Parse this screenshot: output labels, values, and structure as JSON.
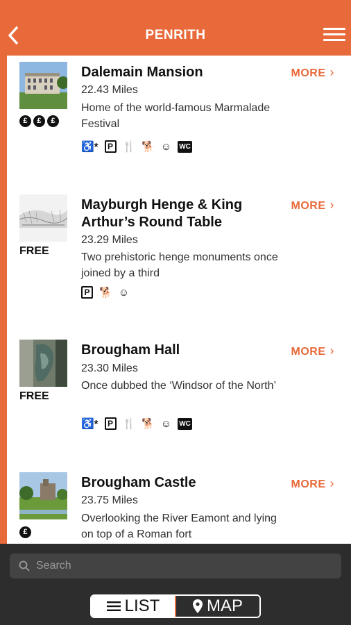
{
  "header": {
    "title": "PENRITH"
  },
  "items": [
    {
      "name": "Dalemain Mansion",
      "distance": "22.43 Miles",
      "description": "Home of the world-famous Marmalade Festival",
      "more": "MORE",
      "price_coins": 3,
      "price_text": ""
    },
    {
      "name": "Mayburgh Henge & King Arthur’s Round Table",
      "distance": "23.29 Miles",
      "description": "Two prehistoric henge monuments once joined by a third",
      "more": "MORE",
      "price_coins": 0,
      "price_text": "FREE"
    },
    {
      "name": "Brougham Hall",
      "distance": "23.30 Miles",
      "description": "Once dubbed the ‘Windsor of the North’",
      "more": "MORE",
      "price_coins": 0,
      "price_text": "FREE"
    },
    {
      "name": "Brougham Castle",
      "distance": "23.75 Miles",
      "description": "Overlooking the River Eamont and lying on top of a Roman fort",
      "more": "MORE",
      "price_coins": 1,
      "price_text": ""
    }
  ],
  "search": {
    "placeholder": "Search"
  },
  "segmented": {
    "list": "LIST",
    "map": "MAP"
  },
  "colors": {
    "accent": "#e8693a",
    "bottom_bar": "#2d2d2d"
  }
}
